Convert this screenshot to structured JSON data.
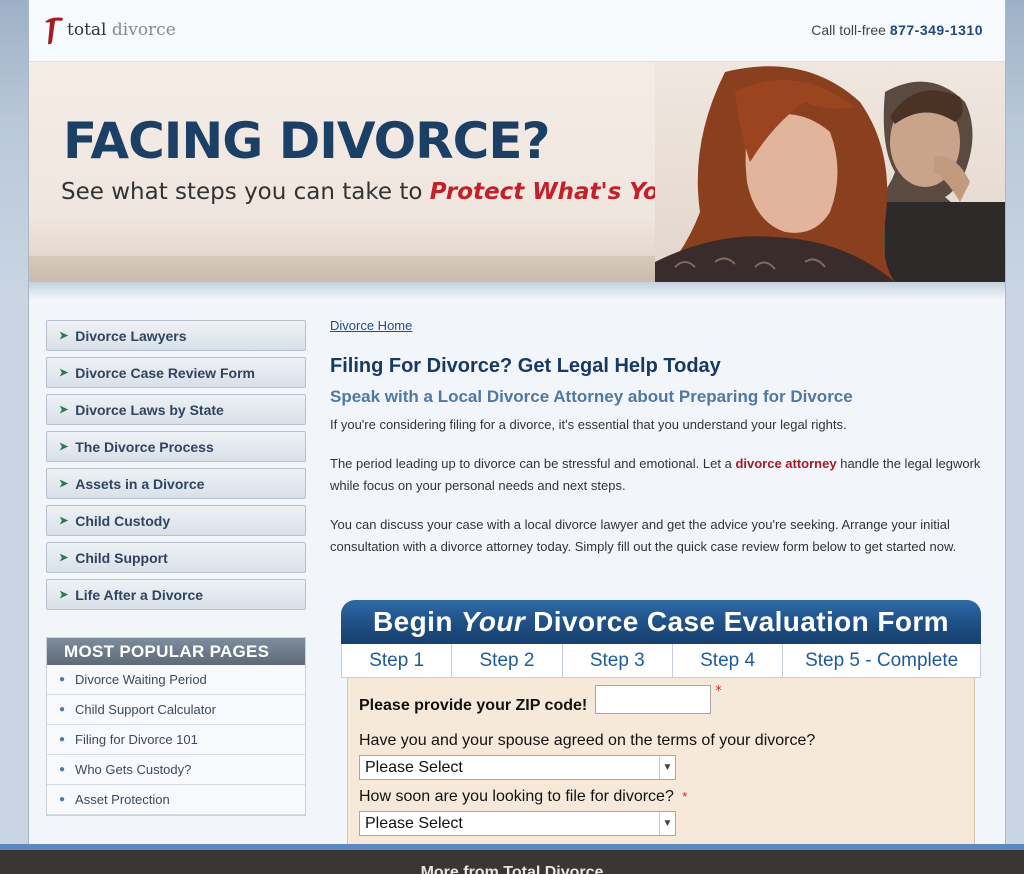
{
  "header": {
    "logo_bold": "total",
    "logo_light": "divorce",
    "phone_prefix": "Call toll-free",
    "phone_number": "877-349-1310"
  },
  "hero": {
    "title": "FACING DIVORCE?",
    "subtitle_prefix": "See what steps you can take to",
    "subtitle_highlight": "Protect What's Yours."
  },
  "sidebar": {
    "items": [
      {
        "label": "Divorce Lawyers"
      },
      {
        "label": "Divorce Case Review Form"
      },
      {
        "label": "Divorce Laws by State"
      },
      {
        "label": "The Divorce Process"
      },
      {
        "label": "Assets in a Divorce"
      },
      {
        "label": "Child Custody"
      },
      {
        "label": "Child Support"
      },
      {
        "label": "Life After a Divorce"
      }
    ],
    "popular_heading": "MOST POPULAR PAGES",
    "popular": [
      {
        "label": "Divorce Waiting Period"
      },
      {
        "label": "Child Support Calculator"
      },
      {
        "label": "Filing for Divorce 101"
      },
      {
        "label": "Who Gets Custody?"
      },
      {
        "label": "Asset Protection"
      }
    ]
  },
  "main": {
    "breadcrumb": "Divorce Home",
    "title": "Filing For Divorce? Get Legal Help Today",
    "subtitle": "Speak with a Local Divorce Attorney about Preparing for Divorce",
    "p1": "If you're considering filing for a divorce, it's essential that you understand your legal rights.",
    "p2_before": "The period leading up to divorce can be stressful and emotional. Let a",
    "p2_link": "divorce attorney",
    "p2_after": "handle the legal legwork while focus on your personal needs and next steps.",
    "p3": "You can discuss your case with a local divorce lawyer and get the advice you're seeking. Arrange your initial consultation with a divorce attorney today. Simply fill out the quick case review form below to get started now."
  },
  "form": {
    "title_begin": "Begin",
    "title_your": "Your",
    "title_rest": "Divorce Case Evaluation Form",
    "steps": [
      {
        "label": "Step 1"
      },
      {
        "label": "Step 2"
      },
      {
        "label": "Step 3"
      },
      {
        "label": "Step 4"
      },
      {
        "label": "Step 5 - Complete"
      }
    ],
    "zip_label": "Please provide your ZIP code!",
    "zip_value": "",
    "required_mark": "*",
    "q1": "Have you and your spouse agreed on the terms of your divorce?",
    "q1_value": "Please Select",
    "q2": "How soon are you looking to file for divorce?",
    "q2_value": "Please Select"
  },
  "footer": {
    "text": "More from Total Divorce"
  },
  "colors": {
    "brand_navy": "#173a63",
    "accent_red": "#c4202a",
    "link_blue": "#1d4f86",
    "form_header": "#1e4f84",
    "form_body": "#f6e9da"
  }
}
